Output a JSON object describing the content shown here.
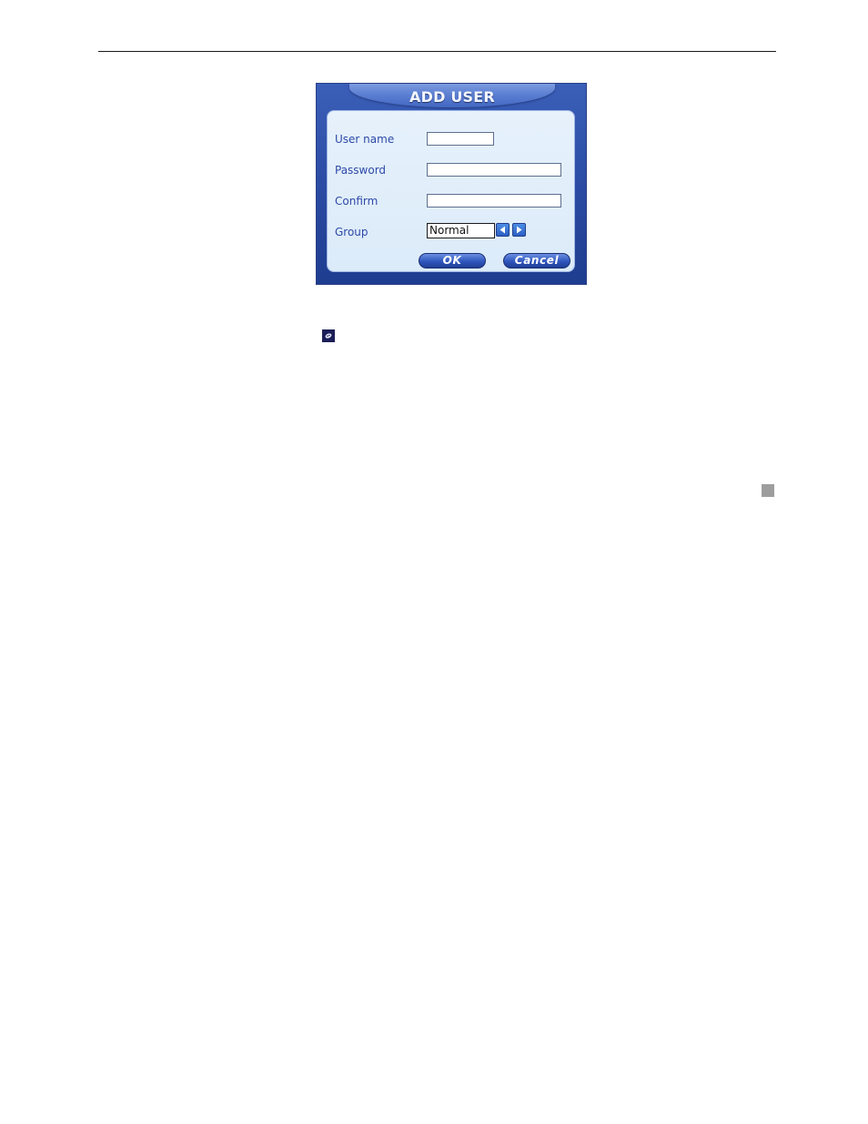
{
  "dialog": {
    "title": "ADD USER",
    "fields": {
      "username": {
        "label": "User name",
        "value": "",
        "placeholder": ""
      },
      "password": {
        "label": "Password",
        "value": "",
        "placeholder": ""
      },
      "confirm": {
        "label": "Confirm",
        "value": "",
        "placeholder": ""
      },
      "group": {
        "label": "Group",
        "selected": "Normal"
      }
    },
    "buttons": {
      "ok": "OK",
      "cancel": "Cancel"
    },
    "icons": {
      "prev": "chevron-left-icon",
      "next": "chevron-right-icon"
    }
  },
  "page": {
    "inline_icon": "remote-control-icon"
  },
  "colors": {
    "dialog_frame": "#2a4aa2",
    "dialog_panel": "#e0eefa",
    "label_text": "#2d49a8",
    "button": "#2f56bd"
  }
}
